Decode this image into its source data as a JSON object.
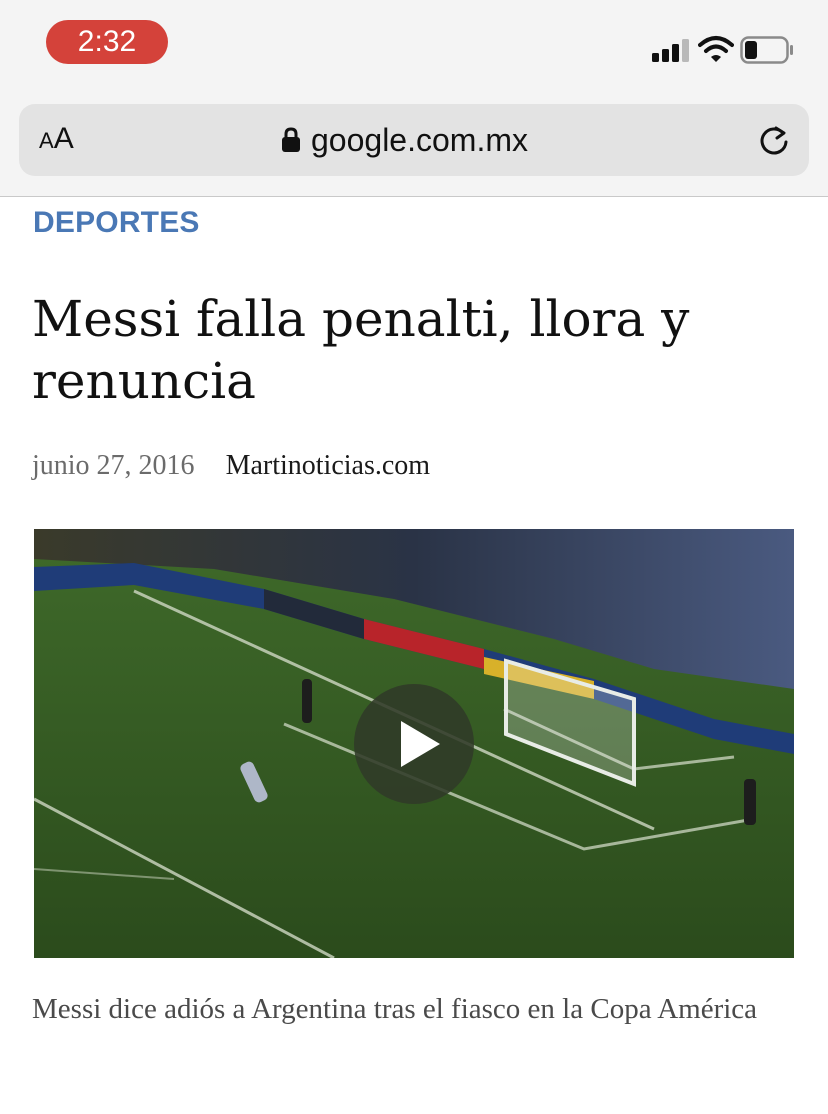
{
  "status_bar": {
    "time": "2:32",
    "signal_icon": "cellular-signal-icon",
    "wifi_icon": "wifi-icon",
    "battery_icon": "battery-icon",
    "time_pill_color": "#d4423a"
  },
  "browser": {
    "text_size_small": "A",
    "text_size_big": "A",
    "lock_icon": "lock-icon",
    "domain": "google.com.mx",
    "reload_icon": "reload-icon"
  },
  "article": {
    "section": "DEPORTES",
    "section_color": "#4a78b5",
    "headline": "Messi falla penalti, llora y renuncia",
    "date": "junio 27, 2016",
    "source": "Martinoticias.com",
    "video": {
      "play_icon": "play-icon"
    },
    "caption": "Messi dice adiós a Argentina tras el fiasco en la Copa América"
  }
}
